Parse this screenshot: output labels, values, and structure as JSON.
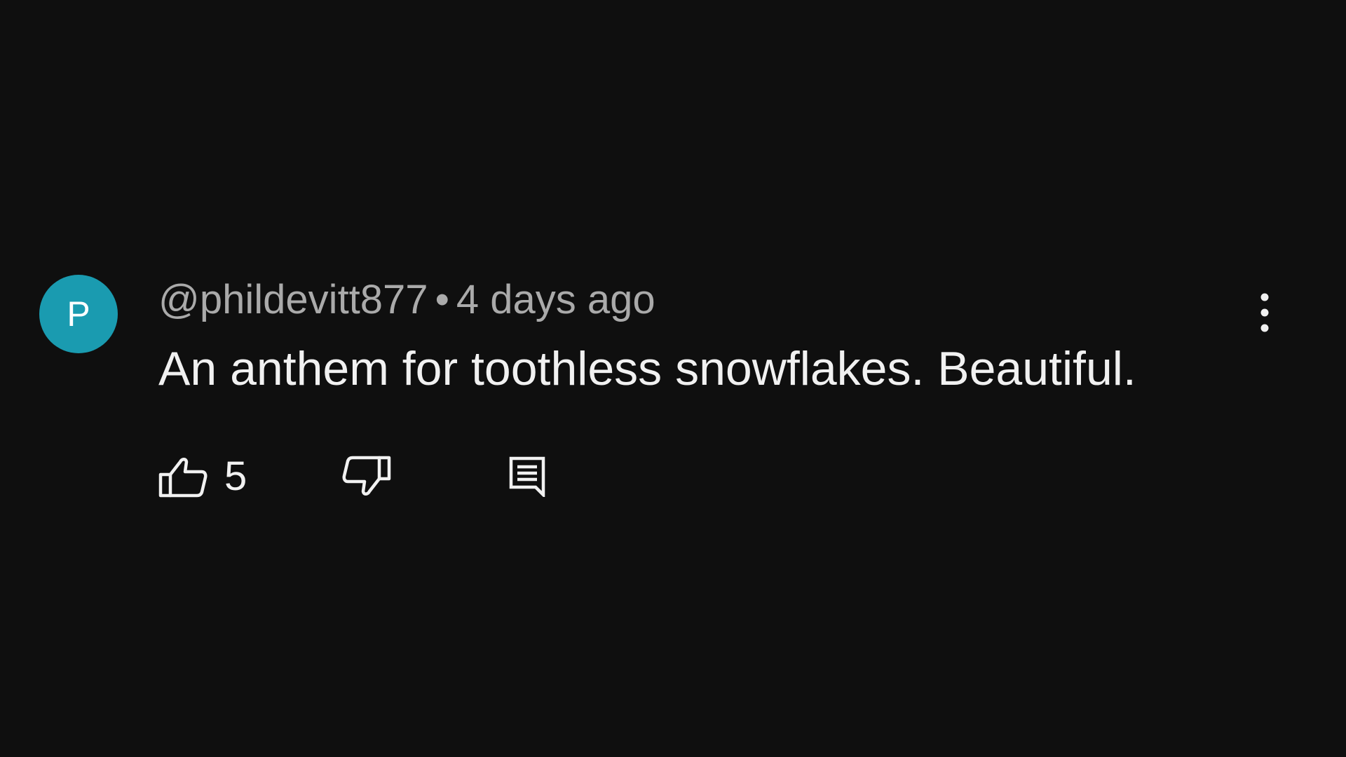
{
  "comment": {
    "avatar_letter": "P",
    "avatar_color": "#1a9bb0",
    "author": "@phildevitt877",
    "separator": "•",
    "time": "4 days ago",
    "text": "An anthem for toothless snowflakes. Beautiful.",
    "like_count": "5",
    "icons": {
      "like": "thumbs-up-icon",
      "dislike": "thumbs-down-icon",
      "reply": "reply-comment-icon",
      "more": "more-vertical-icon"
    }
  },
  "colors": {
    "background": "#0f0f0f",
    "text_primary": "#f1f1f1",
    "text_secondary": "#aaaaaa"
  }
}
